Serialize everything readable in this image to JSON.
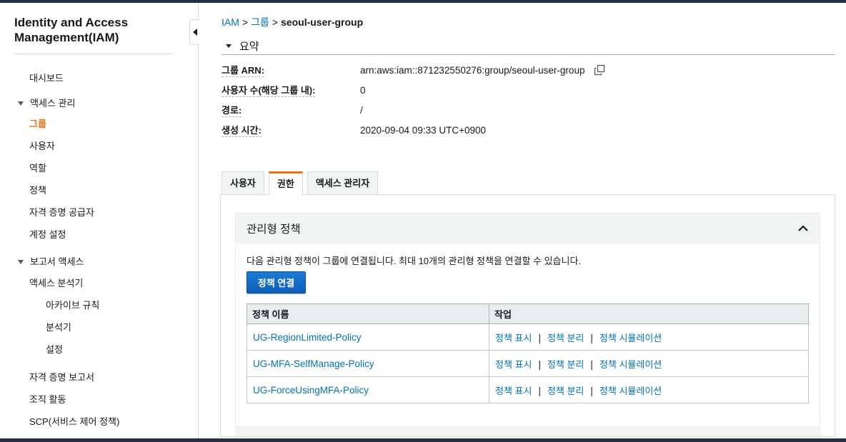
{
  "sidebar": {
    "title": "Identity and Access Management(IAM)",
    "dashboard": "대시보드",
    "access_management": {
      "label": "액세스 관리",
      "items": [
        "그룹",
        "사용자",
        "역할",
        "정책",
        "자격 증명 공급자",
        "계정 설정"
      ]
    },
    "reports": {
      "label": "보고서 액세스",
      "analyzer": "액세스 분석기",
      "sub_items": [
        "아카이브 규칙",
        "분석기",
        "설정"
      ],
      "items": [
        "자격 증명 보고서",
        "조직 활동",
        "SCP(서비스 제어 정책)"
      ]
    },
    "active_item": "그룹"
  },
  "breadcrumb": {
    "root": "IAM",
    "sep": ">",
    "groups": "그룹",
    "current": "seoul-user-group"
  },
  "summary": {
    "title": "요약",
    "rows": [
      {
        "label": "그룹 ARN:",
        "value": "arn:aws:iam::871232550276:group/seoul-user-group"
      },
      {
        "label": "사용자 수(해당 그룹 내):",
        "value": "0"
      },
      {
        "label": "경로:",
        "value": "/"
      },
      {
        "label": "생성 시간:",
        "value": "2020-09-04 09:33 UTC+0900"
      }
    ]
  },
  "tabs": [
    {
      "label": "사용자",
      "active": false
    },
    {
      "label": "권한",
      "active": true
    },
    {
      "label": "액세스 관리자",
      "active": false
    }
  ],
  "managed_policies": {
    "title": "관리형 정책",
    "description": "다음 관리형 정책이 그룹에 연결됩니다. 최대 10개의 관리형 정책을 연결할 수 있습니다.",
    "attach_button": "정책 연결",
    "columns": [
      "정책 이름",
      "작업"
    ],
    "rows": [
      {
        "name": "UG-RegionLimited-Policy"
      },
      {
        "name": "UG-MFA-SelfManage-Policy"
      },
      {
        "name": "UG-ForceUsingMFA-Policy"
      }
    ],
    "actions": {
      "show": "정책 표시",
      "detach": "정책 분리",
      "simulate": "정책 시뮬레이션",
      "sep": "|"
    }
  },
  "colors": {
    "link": "#0073bb",
    "active_accent": "#ec7211",
    "primary_button": "#0f5fb8",
    "topbar": "#232f3e"
  }
}
